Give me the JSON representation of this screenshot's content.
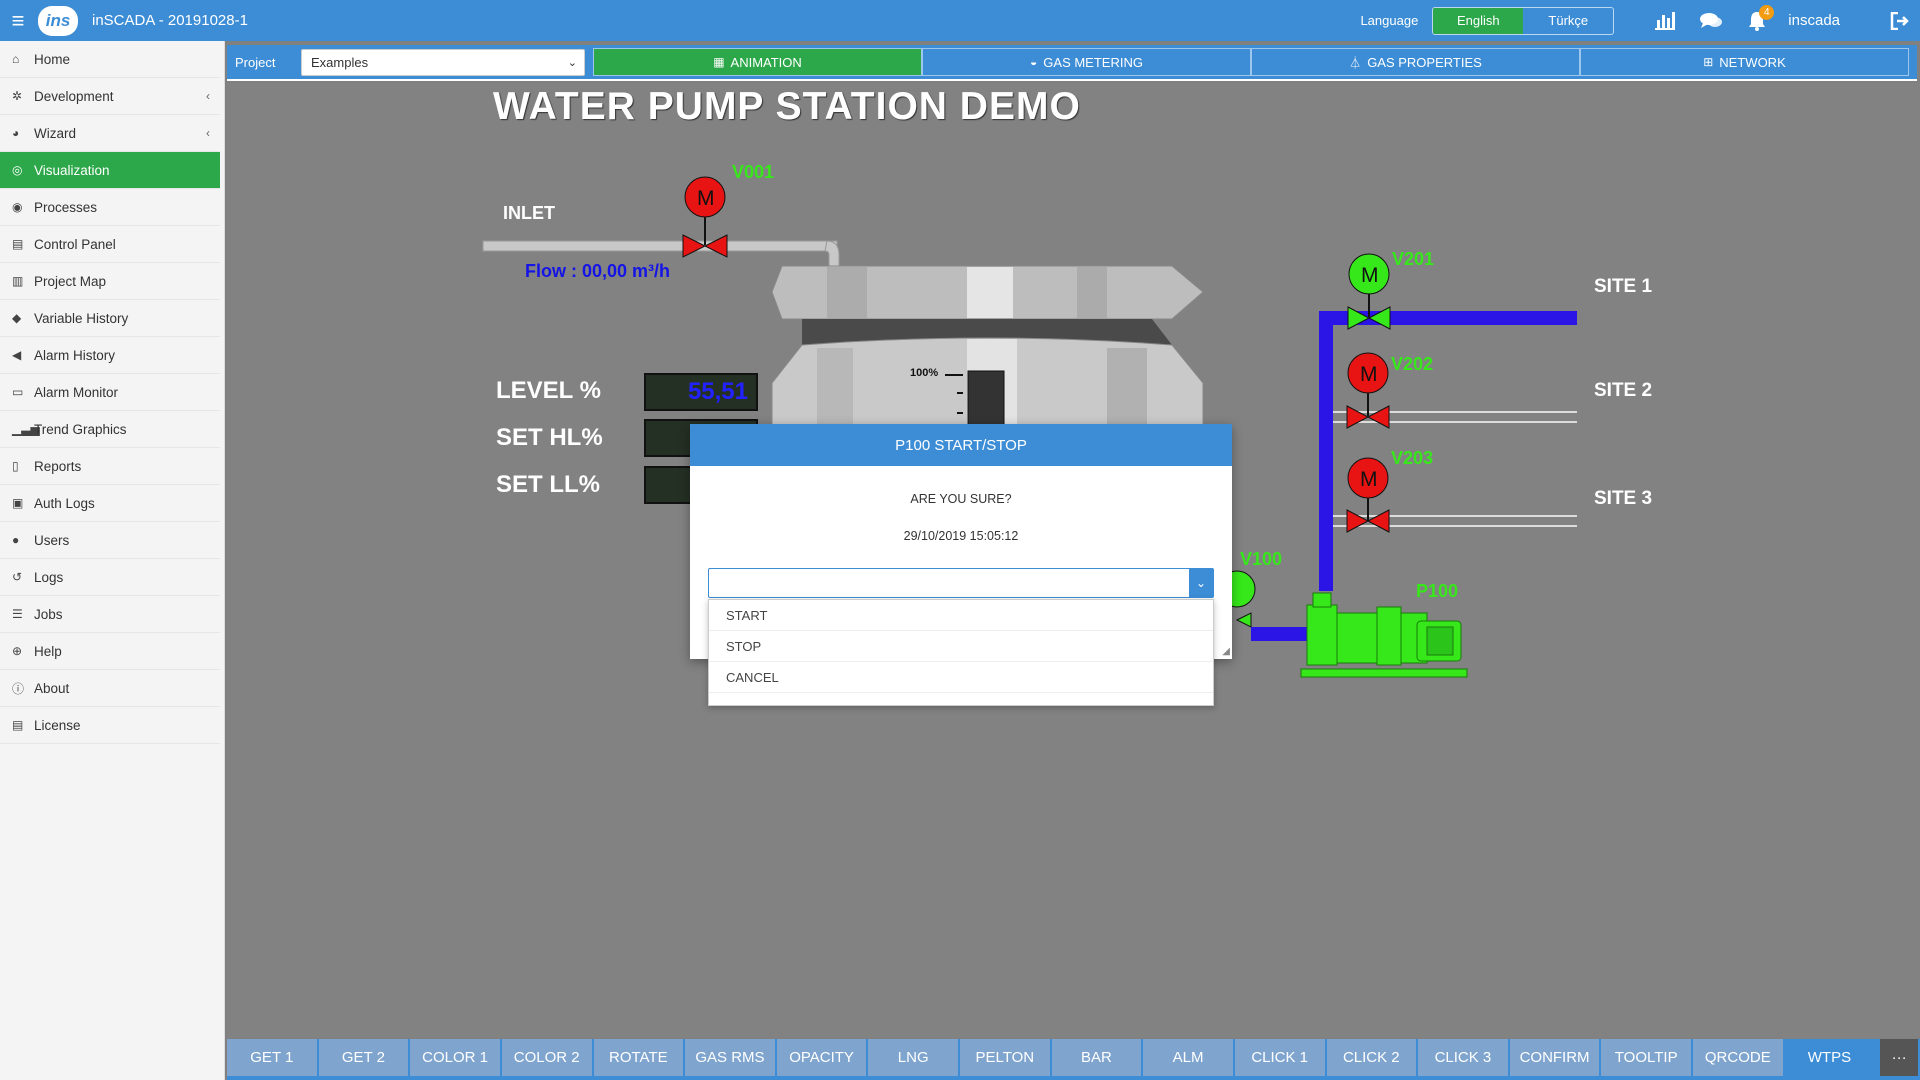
{
  "app": {
    "title": "inSCADA - 20191028-1",
    "logo": "ins"
  },
  "topbar": {
    "language_label": "Language",
    "languages": [
      {
        "label": "English"
      },
      {
        "label": "Türkçe"
      }
    ],
    "notification_count": "4",
    "username": "inscada"
  },
  "sidebar": {
    "items": [
      {
        "label": "Home",
        "icon": "home-icon"
      },
      {
        "label": "Development",
        "icon": "cogs-icon"
      },
      {
        "label": "Wizard",
        "icon": "wizard-icon"
      },
      {
        "label": "Visualization",
        "icon": "eye-icon"
      },
      {
        "label": "Processes",
        "icon": "circle-icon"
      },
      {
        "label": "Control Panel",
        "icon": "panel-icon"
      },
      {
        "label": "Project Map",
        "icon": "map-icon"
      },
      {
        "label": "Variable History",
        "icon": "tags-icon"
      },
      {
        "label": "Alarm History",
        "icon": "bullhorn-icon"
      },
      {
        "label": "Alarm Monitor",
        "icon": "monitor-icon"
      },
      {
        "label": "Trend Graphics",
        "icon": "signal-icon"
      },
      {
        "label": "Reports",
        "icon": "pdf-icon"
      },
      {
        "label": "Auth Logs",
        "icon": "id-card-icon"
      },
      {
        "label": "Users",
        "icon": "user-icon"
      },
      {
        "label": "Logs",
        "icon": "history-icon"
      },
      {
        "label": "Jobs",
        "icon": "tasks-icon"
      },
      {
        "label": "Help",
        "icon": "lifebuoy-icon"
      },
      {
        "label": "About",
        "icon": "info-icon"
      },
      {
        "label": "License",
        "icon": "license-icon"
      }
    ]
  },
  "project": {
    "label": "Project",
    "selected": "Examples",
    "tabs": [
      {
        "label": "ANIMATION"
      },
      {
        "label": "GAS METERING"
      },
      {
        "label": "GAS PROPERTIES"
      },
      {
        "label": "NETWORK"
      }
    ]
  },
  "scada": {
    "title": "WATER PUMP STATION DEMO",
    "inlet": "INLET",
    "flow": "Flow : 00,00 m³/h",
    "v001": "V001",
    "v201": "V201",
    "v202": "V202",
    "v203": "V203",
    "v100": "V100",
    "p100": "P100",
    "site1": "SITE 1",
    "site2": "SITE 2",
    "site3": "SITE 3",
    "level_label": "LEVEL %",
    "level_value": "55,51",
    "set_hl_label": "SET HL%",
    "set_ll_label": "SET LL%",
    "tank_scale_top": "100%",
    "motor_letter": "M"
  },
  "modal": {
    "title": "P100 START/STOP",
    "question": "ARE YOU SURE?",
    "datetime": "29/10/2019 15:05:12",
    "selected_value": "",
    "options": [
      {
        "label": "START"
      },
      {
        "label": "STOP"
      },
      {
        "label": "CANCEL"
      }
    ]
  },
  "bottom_tabs": [
    {
      "label": "GET 1"
    },
    {
      "label": "GET 2"
    },
    {
      "label": "COLOR 1"
    },
    {
      "label": "COLOR 2"
    },
    {
      "label": "ROTATE"
    },
    {
      "label": "GAS RMS"
    },
    {
      "label": "OPACITY"
    },
    {
      "label": "LNG"
    },
    {
      "label": "PELTON"
    },
    {
      "label": "BAR"
    },
    {
      "label": "ALM"
    },
    {
      "label": "CLICK 1"
    },
    {
      "label": "CLICK 2"
    },
    {
      "label": "CLICK 3"
    },
    {
      "label": "CONFIRM"
    },
    {
      "label": "TOOLTIP"
    },
    {
      "label": "QRCODE"
    },
    {
      "label": "WTPS"
    }
  ],
  "bottom_more": "···",
  "colors": {
    "accent": "#3c8dd6",
    "active_green": "#2ca84a",
    "valve_red": "#e81414",
    "valve_green": "#36e81a",
    "pipe_blue": "#2a14e6"
  }
}
